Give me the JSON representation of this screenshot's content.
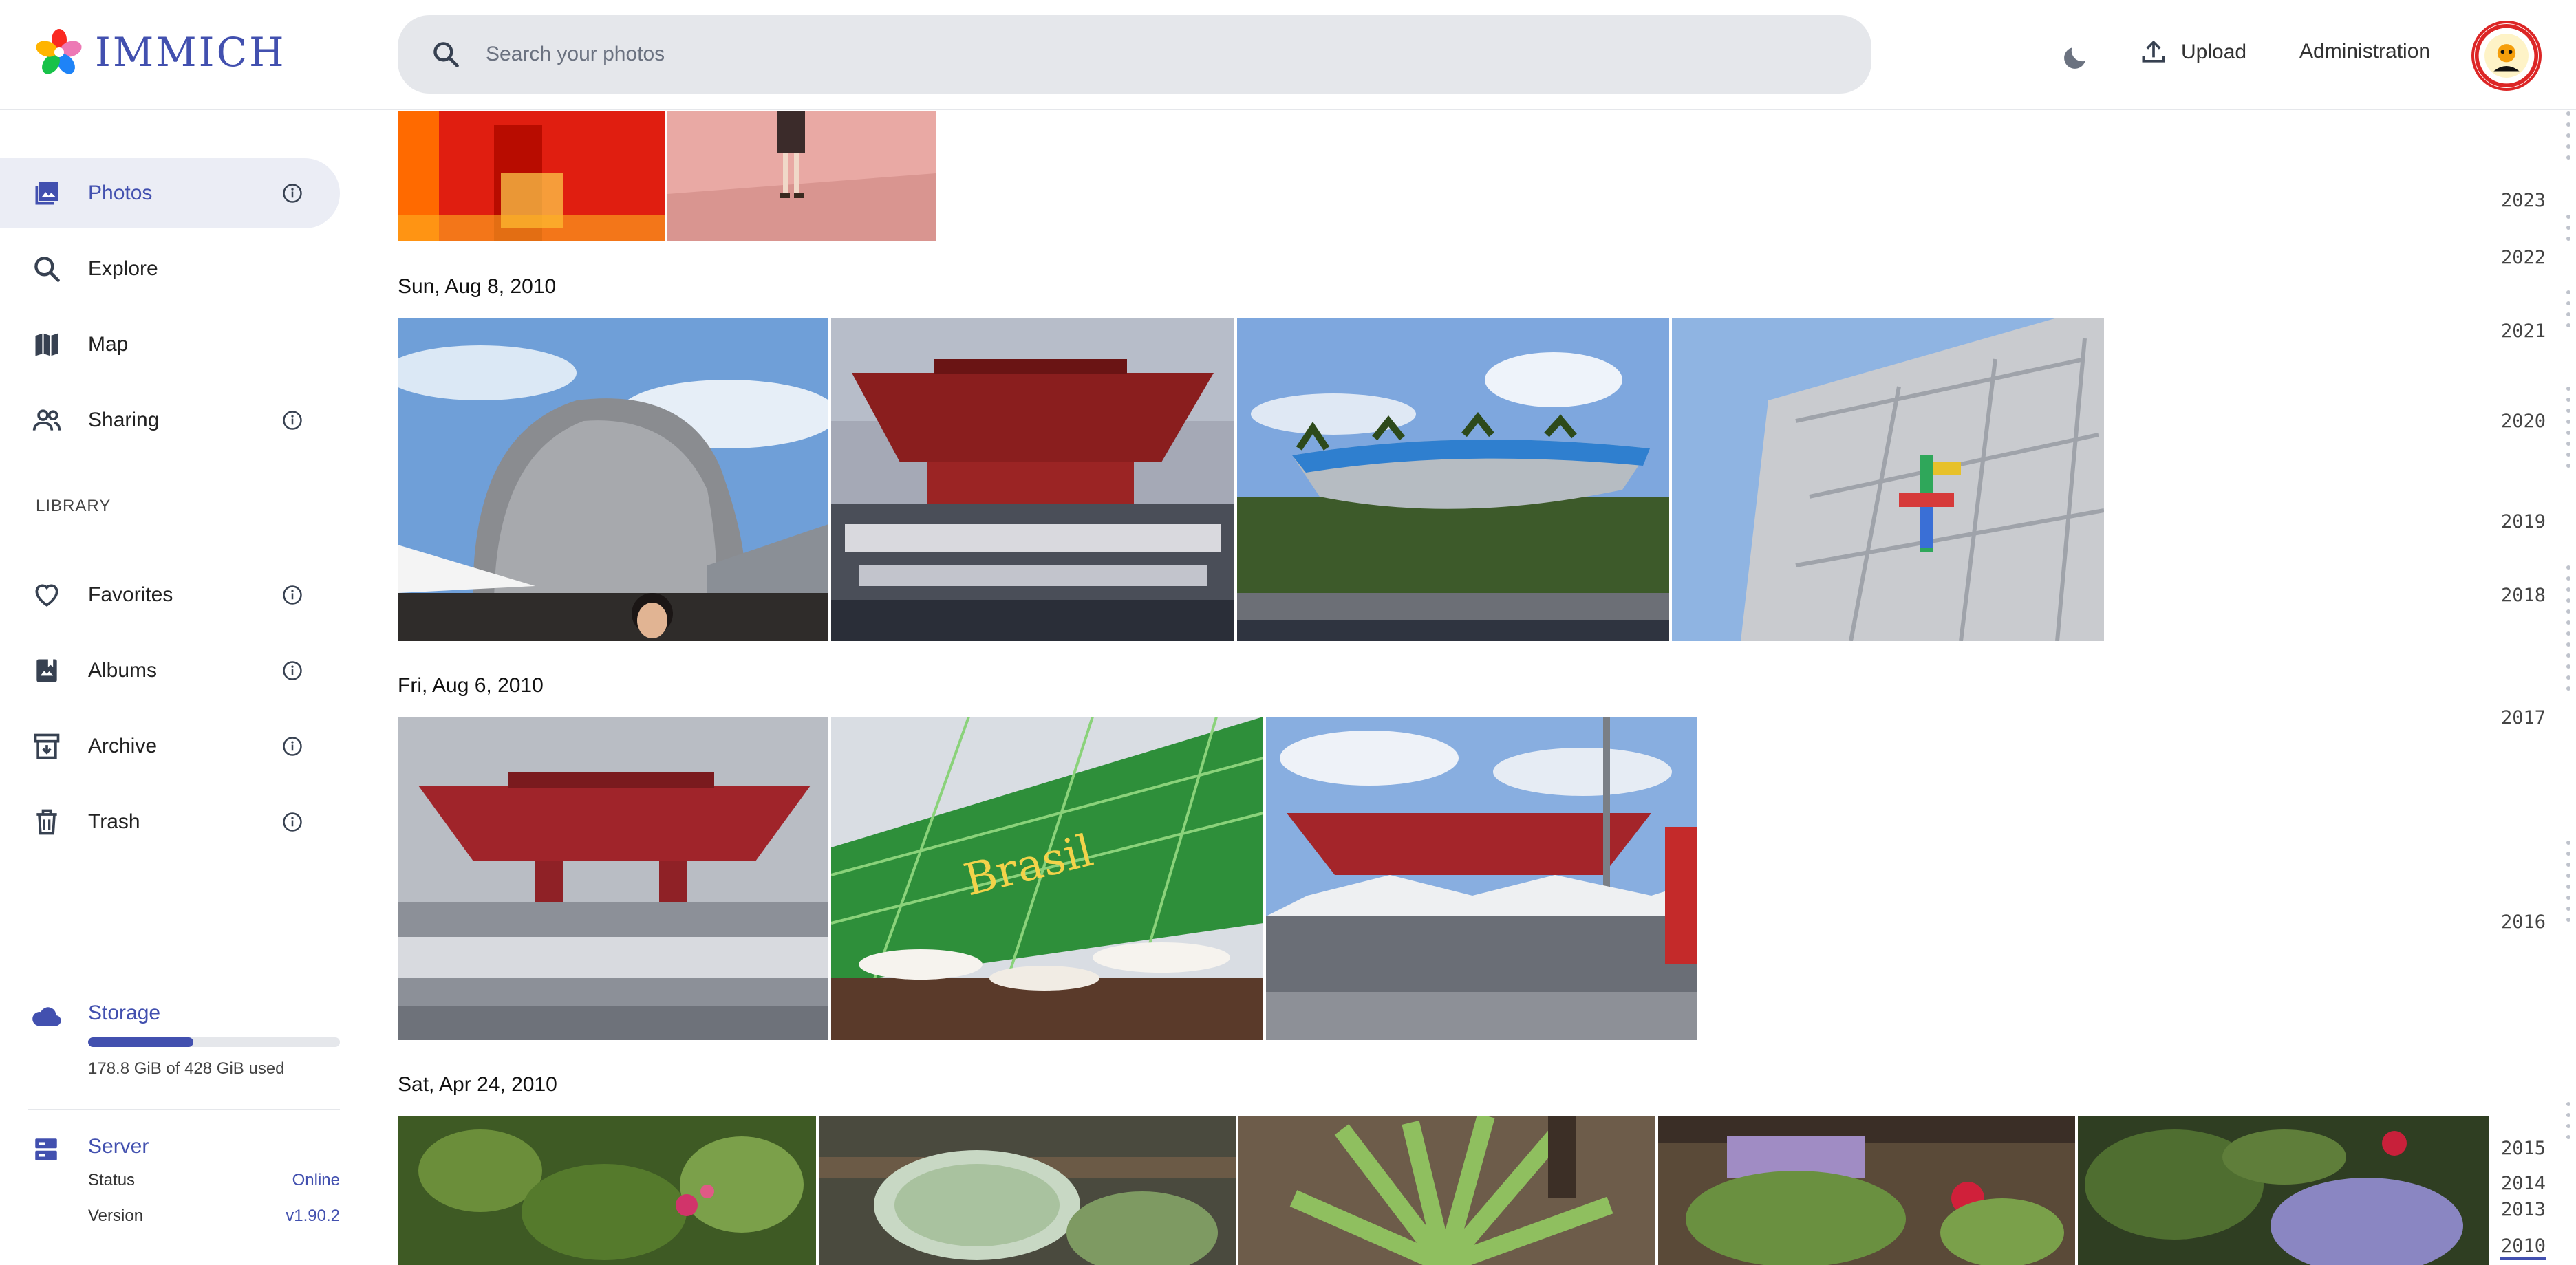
{
  "app": {
    "name": "IMMICH"
  },
  "search": {
    "placeholder": "Search your photos"
  },
  "header": {
    "upload_label": "Upload",
    "admin_label": "Administration"
  },
  "sidebar": {
    "items": [
      {
        "label": "Photos",
        "icon": "photos-icon",
        "active": true,
        "info": true
      },
      {
        "label": "Explore",
        "icon": "explore-icon",
        "info": false
      },
      {
        "label": "Map",
        "icon": "map-icon",
        "info": false
      },
      {
        "label": "Sharing",
        "icon": "sharing-icon",
        "info": true
      }
    ],
    "library_label": "LIBRARY",
    "library_items": [
      {
        "label": "Favorites",
        "icon": "heart-icon",
        "info": true
      },
      {
        "label": "Albums",
        "icon": "albums-icon",
        "info": true
      },
      {
        "label": "Archive",
        "icon": "archive-icon",
        "info": true
      },
      {
        "label": "Trash",
        "icon": "trash-icon",
        "info": true
      }
    ]
  },
  "storage": {
    "title": "Storage",
    "used_text": "178.8 GiB of 428 GiB used",
    "used_fraction": 0.418
  },
  "server": {
    "title": "Server",
    "status_label": "Status",
    "status_value": "Online",
    "version_label": "Version",
    "version_value": "v1.90.2"
  },
  "timeline": {
    "groups": [
      {
        "date": "Sun, Aug 8, 2010"
      },
      {
        "date": "Fri, Aug 6, 2010"
      },
      {
        "date": "Sat, Apr 24, 2010"
      }
    ]
  },
  "scrubber": {
    "years": [
      "2023",
      "2022",
      "2021",
      "2020",
      "2019",
      "2018",
      "2017",
      "2016",
      "2015",
      "2014",
      "2013",
      "2010"
    ]
  },
  "colors": {
    "accent": "#4250af",
    "active_bg": "#ebedf5",
    "search_bg": "#e5e7eb"
  }
}
